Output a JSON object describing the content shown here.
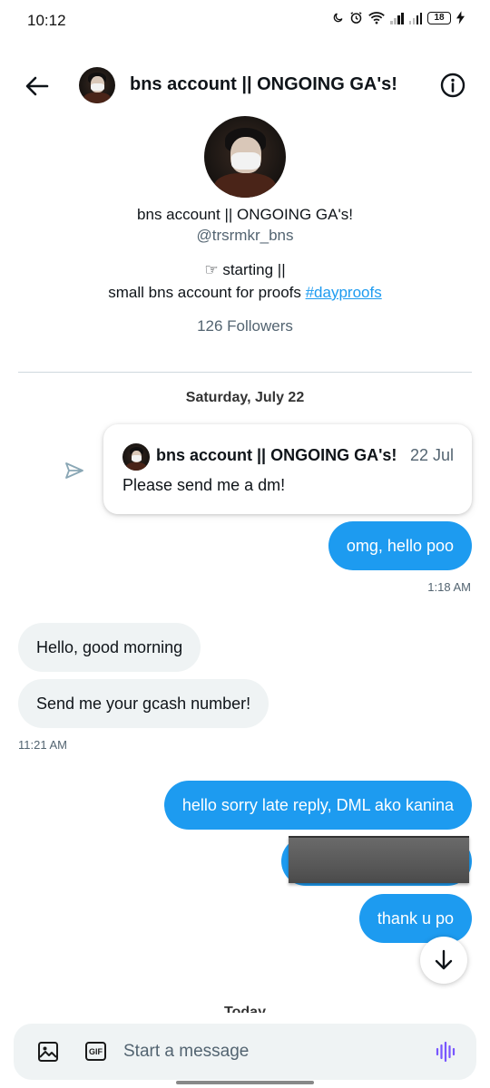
{
  "status_bar": {
    "time": "10:12",
    "battery": "18"
  },
  "header": {
    "title": "bns account || ONGOING GA's!"
  },
  "profile": {
    "name": "bns account || ONGOING GA's!",
    "handle": "@trsrmkr_bns",
    "bio_line1": "☞ starting ||",
    "bio_line2_text": "small bns account for proofs ",
    "bio_hashtag": "#dayproofs",
    "followers": "126 Followers"
  },
  "conversation": {
    "date_separator": "Saturday, July 22",
    "shared_tweet": {
      "author": "bns account || ONGOING GA's!",
      "date": "22 Jul",
      "text": "Please send me a dm!"
    },
    "messages": [
      {
        "direction": "out",
        "text": "omg, hello poo",
        "time": "1:18 AM"
      },
      {
        "direction": "in",
        "text": "Hello, good morning"
      },
      {
        "direction": "in",
        "text": "Send me your gcash number!",
        "time": "11:21 AM"
      },
      {
        "direction": "out",
        "text": "hello sorry late reply, DML ako kanina"
      },
      {
        "direction": "out",
        "text": "",
        "redacted": true
      },
      {
        "direction": "out",
        "text": "thank u po"
      }
    ],
    "next_separator": "Today"
  },
  "composer": {
    "placeholder": "Start a message",
    "gif_label": "GIF"
  },
  "colors": {
    "accent": "#1d9bf0",
    "incoming_bubble": "#eff3f4",
    "muted_text": "#536471"
  },
  "icons": {
    "back": "arrow-left-icon",
    "info": "info-icon",
    "share": "send-icon",
    "image": "image-icon",
    "gif": "gif-icon",
    "voice": "voice-waveform-icon",
    "scroll": "arrow-down-icon"
  }
}
